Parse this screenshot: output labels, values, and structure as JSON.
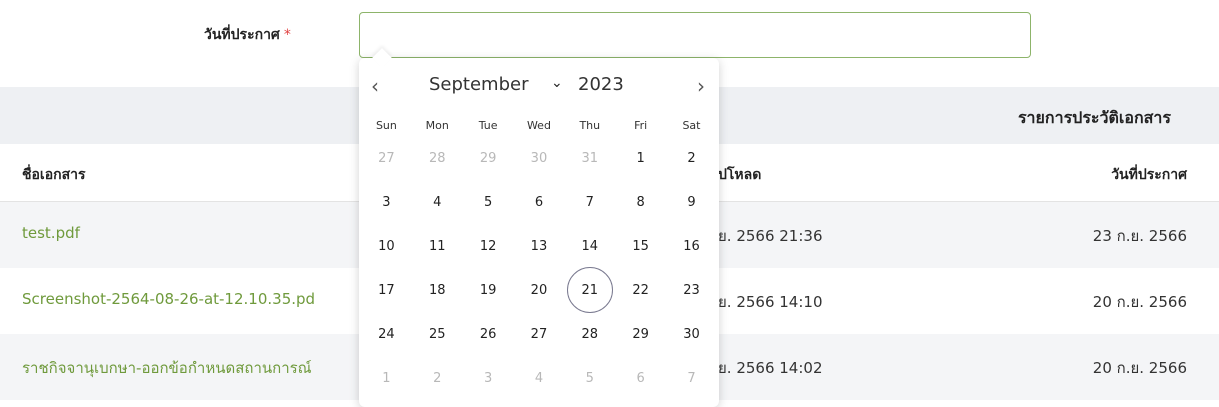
{
  "form": {
    "date_label": "วันที่ประกาศ",
    "required_mark": "*",
    "date_value": ""
  },
  "table": {
    "section_title": "รายการประวัติเอกสาร",
    "headers": {
      "document": "ชื่อเอกสาร",
      "uploaded": "ปโหลด",
      "announced": "วันที่ประกาศ"
    },
    "rows": [
      {
        "document": "test.pdf",
        "uploaded": "ย. 2566 21:36",
        "announced": "23 ก.ย. 2566"
      },
      {
        "document": "Screenshot-2564-08-26-at-12.10.35.pd",
        "uploaded": "ย. 2566 14:10",
        "announced": "20 ก.ย. 2566"
      },
      {
        "document": "ราชกิจจานุเบกษา-ออกข้อกำหนดสถานการณ์",
        "uploaded": "ย. 2566 14:02",
        "announced": "20 ก.ย. 2566"
      }
    ]
  },
  "datepicker": {
    "month": "September",
    "year": "2023",
    "prev_glyph": "‹",
    "next_glyph": "›",
    "dropdown_glyph": "⌄",
    "weekdays": [
      "Sun",
      "Mon",
      "Tue",
      "Wed",
      "Thu",
      "Fri",
      "Sat"
    ],
    "weeks": [
      [
        {
          "d": "27",
          "muted": true
        },
        {
          "d": "28",
          "muted": true
        },
        {
          "d": "29",
          "muted": true
        },
        {
          "d": "30",
          "muted": true
        },
        {
          "d": "31",
          "muted": true
        },
        {
          "d": "1"
        },
        {
          "d": "2"
        }
      ],
      [
        {
          "d": "3"
        },
        {
          "d": "4"
        },
        {
          "d": "5"
        },
        {
          "d": "6"
        },
        {
          "d": "7"
        },
        {
          "d": "8"
        },
        {
          "d": "9"
        }
      ],
      [
        {
          "d": "10"
        },
        {
          "d": "11"
        },
        {
          "d": "12"
        },
        {
          "d": "13"
        },
        {
          "d": "14"
        },
        {
          "d": "15"
        },
        {
          "d": "16"
        }
      ],
      [
        {
          "d": "17"
        },
        {
          "d": "18"
        },
        {
          "d": "19"
        },
        {
          "d": "20"
        },
        {
          "d": "21",
          "today": true
        },
        {
          "d": "22"
        },
        {
          "d": "23"
        }
      ],
      [
        {
          "d": "24"
        },
        {
          "d": "25"
        },
        {
          "d": "26"
        },
        {
          "d": "27"
        },
        {
          "d": "28"
        },
        {
          "d": "29"
        },
        {
          "d": "30"
        }
      ],
      [
        {
          "d": "1",
          "muted": true
        },
        {
          "d": "2",
          "muted": true
        },
        {
          "d": "3",
          "muted": true
        },
        {
          "d": "4",
          "muted": true
        },
        {
          "d": "5",
          "muted": true
        },
        {
          "d": "6",
          "muted": true
        },
        {
          "d": "7",
          "muted": true
        }
      ]
    ]
  },
  "colors": {
    "link": "#6f9a3c",
    "input_border": "#8db46a",
    "required": "#e04040"
  },
  "icons": {
    "prev": "chevron-left-icon",
    "next": "chevron-right-icon",
    "month_dropdown": "chevron-down-icon"
  }
}
